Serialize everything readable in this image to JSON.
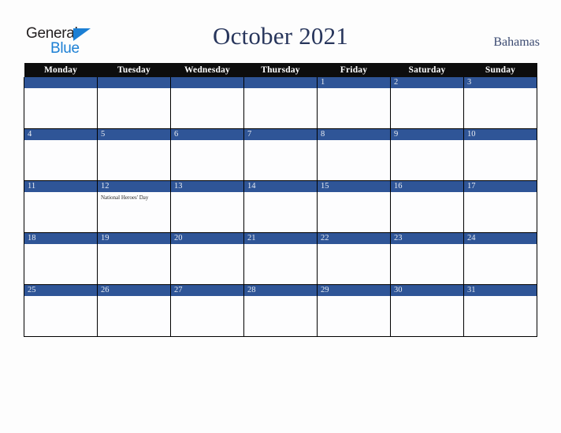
{
  "brand": {
    "name_part1": "General",
    "name_part2": "Blue",
    "triangle_icon": "triangle-icon",
    "color_dark": "#231f20",
    "color_blue": "#1b7fd4"
  },
  "header": {
    "title": "October 2021",
    "country": "Bahamas",
    "title_color": "#28365c",
    "country_color": "#3b4a71"
  },
  "calendar": {
    "month": "October",
    "year": "2021",
    "accent_band_color": "#2f5597",
    "header_bg_color": "#0d0d0d",
    "weekdays": [
      "Monday",
      "Tuesday",
      "Wednesday",
      "Thursday",
      "Friday",
      "Saturday",
      "Sunday"
    ],
    "weeks": [
      [
        {
          "day": "",
          "events": []
        },
        {
          "day": "",
          "events": []
        },
        {
          "day": "",
          "events": []
        },
        {
          "day": "",
          "events": []
        },
        {
          "day": "1",
          "events": []
        },
        {
          "day": "2",
          "events": []
        },
        {
          "day": "3",
          "events": []
        }
      ],
      [
        {
          "day": "4",
          "events": []
        },
        {
          "day": "5",
          "events": []
        },
        {
          "day": "6",
          "events": []
        },
        {
          "day": "7",
          "events": []
        },
        {
          "day": "8",
          "events": []
        },
        {
          "day": "9",
          "events": []
        },
        {
          "day": "10",
          "events": []
        }
      ],
      [
        {
          "day": "11",
          "events": []
        },
        {
          "day": "12",
          "events": [
            "National Heroes' Day"
          ]
        },
        {
          "day": "13",
          "events": []
        },
        {
          "day": "14",
          "events": []
        },
        {
          "day": "15",
          "events": []
        },
        {
          "day": "16",
          "events": []
        },
        {
          "day": "17",
          "events": []
        }
      ],
      [
        {
          "day": "18",
          "events": []
        },
        {
          "day": "19",
          "events": []
        },
        {
          "day": "20",
          "events": []
        },
        {
          "day": "21",
          "events": []
        },
        {
          "day": "22",
          "events": []
        },
        {
          "day": "23",
          "events": []
        },
        {
          "day": "24",
          "events": []
        }
      ],
      [
        {
          "day": "25",
          "events": []
        },
        {
          "day": "26",
          "events": []
        },
        {
          "day": "27",
          "events": []
        },
        {
          "day": "28",
          "events": []
        },
        {
          "day": "29",
          "events": []
        },
        {
          "day": "30",
          "events": []
        },
        {
          "day": "31",
          "events": []
        }
      ]
    ]
  }
}
